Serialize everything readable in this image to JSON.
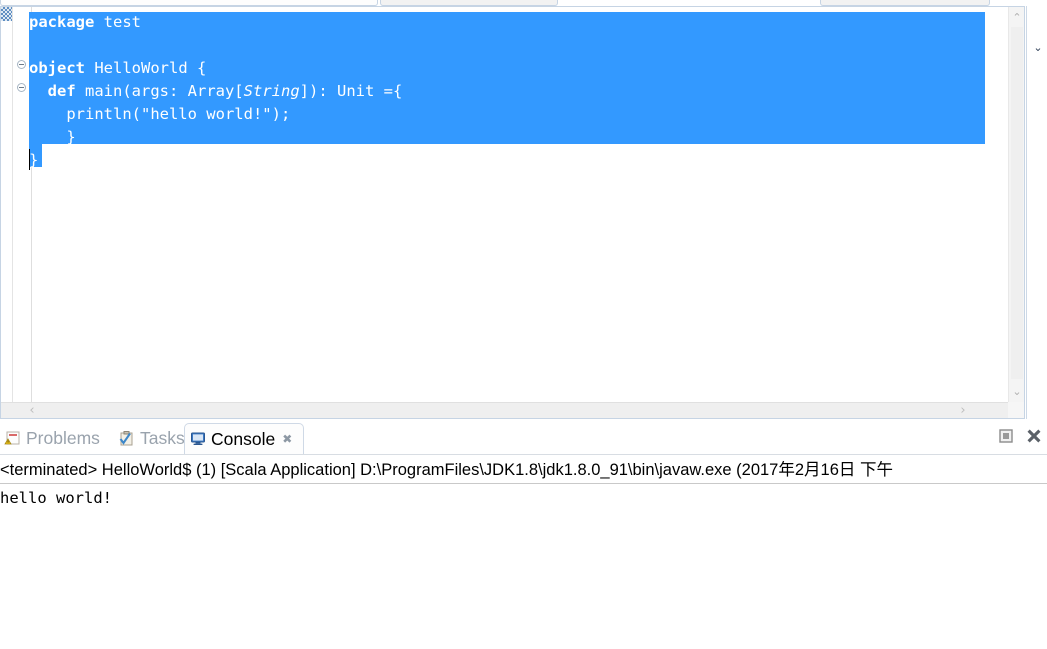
{
  "editor": {
    "selection_color": "#3399ff",
    "code_lines": [
      {
        "text": "package test",
        "selected": true,
        "fold": false
      },
      {
        "text": "",
        "selected": true,
        "fold": false
      },
      {
        "text": "object HelloWorld {",
        "selected": true,
        "fold": true
      },
      {
        "text": "  def main(args: Array[String]): Unit ={",
        "selected": true,
        "fold": true
      },
      {
        "text": "    println(\"hello world!\");",
        "selected": true,
        "fold": false
      },
      {
        "text": "    }",
        "selected": true,
        "fold": false
      },
      {
        "text": "}",
        "selected": true,
        "fold": false
      }
    ],
    "scrollbar": {
      "up_arrow": "⌃",
      "down_arrow": "⌄",
      "left_arrow": "‹",
      "right_arrow": "›"
    },
    "restore_chevron": "⌄"
  },
  "bottom_panel": {
    "tabs": [
      {
        "label": "Problems",
        "icon": "problems-icon",
        "active": false,
        "closable": false
      },
      {
        "label": "Tasks",
        "icon": "tasks-icon",
        "active": false,
        "closable": false
      },
      {
        "label": "Console",
        "icon": "console-icon",
        "active": true,
        "closable": true
      }
    ],
    "close_glyph": "✖",
    "tools": [
      {
        "name": "minimize-button",
        "icon": "minimize-icon"
      },
      {
        "name": "close-panel-button",
        "icon": "close-icon",
        "glyph": "✖"
      }
    ],
    "console": {
      "status_line": "<terminated> HelloWorld$ (1) [Scala Application] D:\\ProgramFiles\\JDK1.8\\jdk1.8.0_91\\bin\\javaw.exe (2017年2月16日 下午",
      "output_line": "hello world!"
    }
  }
}
